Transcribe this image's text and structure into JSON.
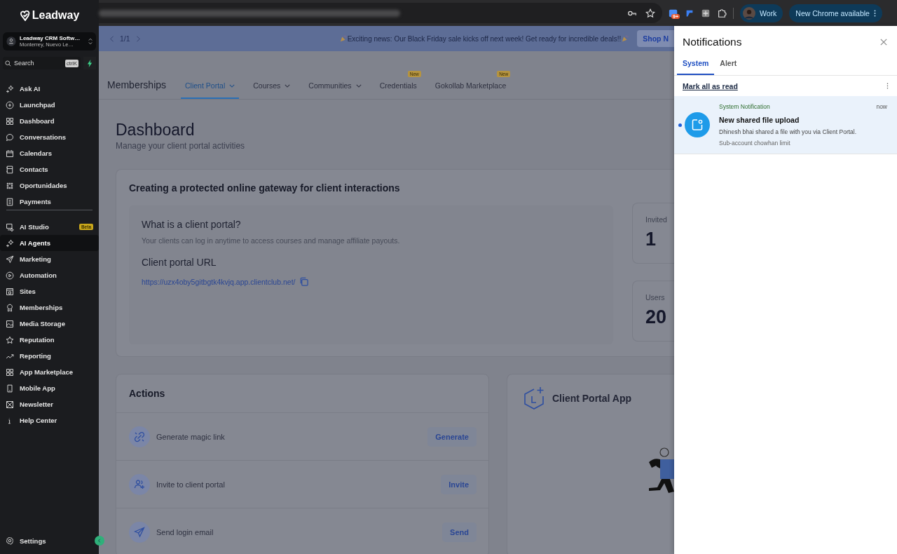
{
  "browser_toolbar": {
    "extension_badge": "9+",
    "profile": "Work",
    "update_button": "New Chrome available"
  },
  "sidebar": {
    "brand": "Leadway",
    "account": {
      "name": "Leadway CRM Softw…",
      "location": "Monterrey, Nuevo Le…"
    },
    "search": {
      "placeholder": "Search",
      "shortcut": "ctrlK"
    },
    "nav_groups": [
      [
        {
          "label": "Ask AI",
          "selected": false
        },
        {
          "label": "Launchpad",
          "selected": false
        },
        {
          "label": "Dashboard",
          "selected": false
        },
        {
          "label": "Conversations",
          "selected": false
        },
        {
          "label": "Calendars",
          "selected": false
        },
        {
          "label": "Contacts",
          "selected": false
        },
        {
          "label": "Oportunidades",
          "selected": false
        },
        {
          "label": "Payments",
          "selected": false
        }
      ],
      [
        {
          "label": "AI Studio",
          "selected": false,
          "badge": "Beta"
        },
        {
          "label": "AI Agents",
          "selected": true
        },
        {
          "label": "Marketing",
          "selected": false
        },
        {
          "label": "Automation",
          "selected": false
        },
        {
          "label": "Sites",
          "selected": false
        },
        {
          "label": "Memberships",
          "selected": false
        },
        {
          "label": "Media Storage",
          "selected": false
        },
        {
          "label": "Reputation",
          "selected": false
        },
        {
          "label": "Reporting",
          "selected": false
        },
        {
          "label": "App Marketplace",
          "selected": false
        },
        {
          "label": "Mobile App",
          "selected": false
        },
        {
          "label": "Newsletter",
          "selected": false
        },
        {
          "label": "Help Center",
          "selected": false
        }
      ]
    ],
    "settings": "Settings"
  },
  "banner": {
    "pager": "1/1",
    "message": "Exciting news: Our Black Friday sale kicks off next week! Get ready for incredible deals!!",
    "button": "Shop N"
  },
  "header": {
    "title": "Memberships",
    "tabs": [
      {
        "label": "Client Portal",
        "selected": true,
        "dropdown": true
      },
      {
        "label": "Courses",
        "selected": false,
        "dropdown": true
      },
      {
        "label": "Communities",
        "selected": false,
        "dropdown": true
      },
      {
        "label": "Credentials",
        "selected": false,
        "dropdown": false,
        "badge": "New"
      },
      {
        "label": "Gokollab Marketplace",
        "selected": false,
        "dropdown": false,
        "badge": "New"
      }
    ]
  },
  "page": {
    "title": "Dashboard",
    "subtitle": "Manage your client portal activities"
  },
  "overview_card": {
    "title": "Creating a protected online gateway for client interactions",
    "question": "What is a client portal?",
    "description": "Your clients can log in anytime to access courses and manage affiliate payouts.",
    "url_label": "Client portal URL",
    "url": "https://uzx4oby5gitbgtk4kvjq.app.clientclub.net/"
  },
  "stats": [
    {
      "label": "Invited",
      "value": "1"
    },
    {
      "label": "Users",
      "value": "20"
    }
  ],
  "actions_card": {
    "title": "Actions",
    "rows": [
      {
        "label": "Generate magic link",
        "button": "Generate"
      },
      {
        "label": "Invite to client portal",
        "button": "Invite"
      },
      {
        "label": "Send login email",
        "button": "Send"
      }
    ]
  },
  "app_card": {
    "title": "Client Portal App"
  },
  "notifications": {
    "title": "Notifications",
    "tabs": [
      {
        "label": "System",
        "selected": true
      },
      {
        "label": "Alert",
        "selected": false
      }
    ],
    "mark_all": "Mark all as read",
    "items": [
      {
        "category": "System Notification",
        "time": "now",
        "title": "New shared file upload",
        "body": "Dhinesh bhai shared a file with you via Client Portal.",
        "account": "Sub-account chowhan limit",
        "unread": true
      }
    ]
  }
}
